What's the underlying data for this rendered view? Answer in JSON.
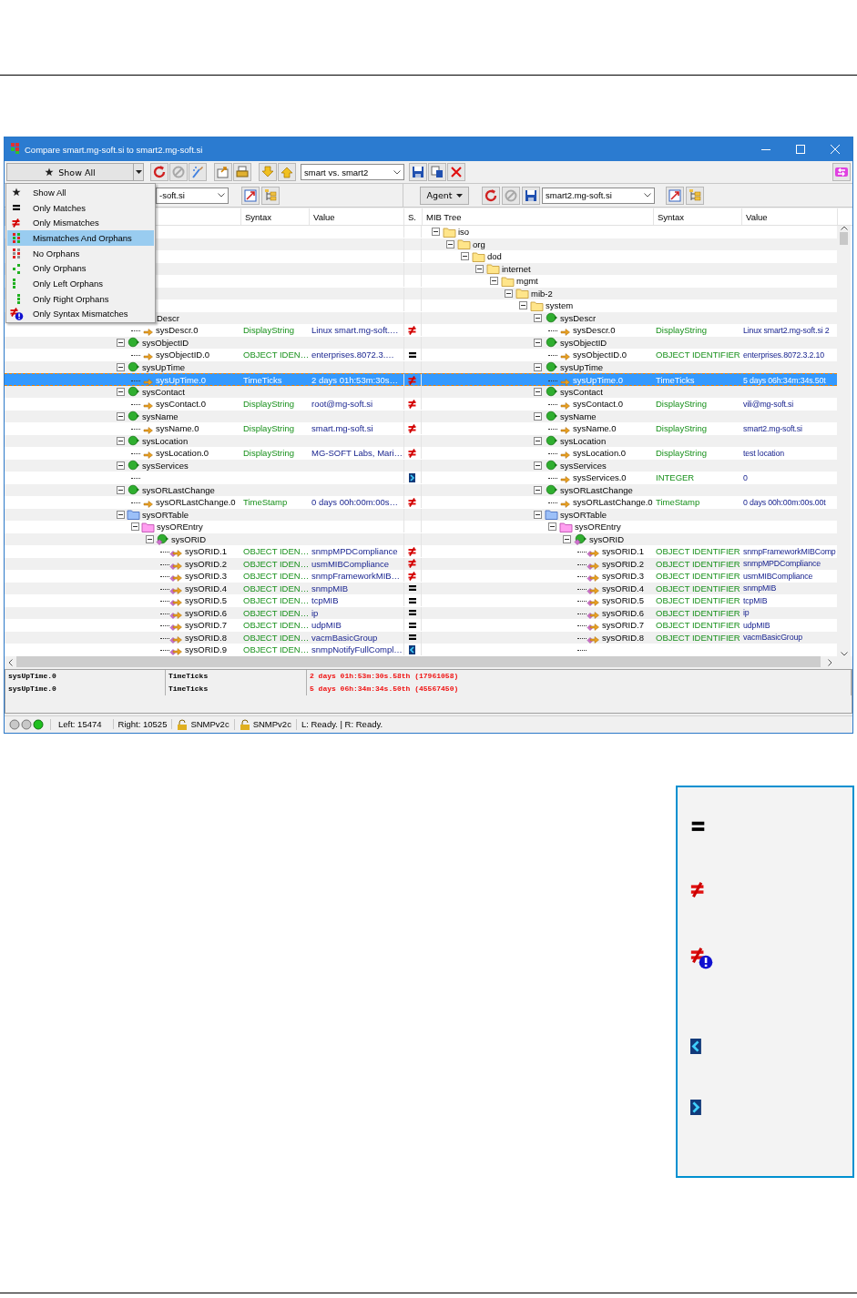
{
  "window": {
    "title": "Compare smart.mg-soft.si to smart2.mg-soft.si"
  },
  "toolbar": {
    "filter": "Show All",
    "profile": "smart vs. smart2"
  },
  "menu": {
    "items": [
      {
        "kind": "all",
        "label": "Show All",
        "selected": false
      },
      {
        "kind": "matches",
        "label": "Only Matches",
        "selected": false
      },
      {
        "kind": "mismatches",
        "label": "Only Mismatches",
        "selected": false
      },
      {
        "kind": "mismatches_orphans",
        "label": "Mismatches And Orphans",
        "selected": true
      },
      {
        "kind": "no_orphans",
        "label": "No Orphans",
        "selected": false
      },
      {
        "kind": "orphans",
        "label": "Only Orphans",
        "selected": false
      },
      {
        "kind": "left_orphans",
        "label": "Only Left Orphans",
        "selected": false
      },
      {
        "kind": "right_orphans",
        "label": "Only Right Orphans",
        "selected": false
      },
      {
        "kind": "syntax",
        "label": "Only Syntax Mismatches",
        "selected": false
      }
    ]
  },
  "left_pane": {
    "agent_file": "-soft.si"
  },
  "right_pane": {
    "agent_button": "Agent",
    "agent_file": "smart2.mg-soft.si"
  },
  "columns": {
    "left": [
      "Syntax",
      "Value"
    ],
    "status": "S.",
    "right": [
      "MIB Tree",
      "Syntax",
      "Value"
    ]
  },
  "tree": [
    {
      "kind": "folder",
      "right": {
        "name": "iso"
      },
      "expanded": true,
      "selected": false,
      "children": [
        {
          "kind": "folder",
          "right": {
            "name": "org"
          },
          "expanded": true,
          "selected": false,
          "children": [
            {
              "kind": "folder",
              "right": {
                "name": "dod"
              },
              "expanded": true,
              "selected": false,
              "children": [
                {
                  "kind": "folder",
                  "right": {
                    "name": "internet"
                  },
                  "expanded": true,
                  "selected": false,
                  "children": [
                    {
                      "kind": "folder",
                      "right": {
                        "name": "mgmt"
                      },
                      "expanded": true,
                      "selected": false,
                      "children": [
                        {
                          "kind": "folder",
                          "right": {
                            "name": "mib-2"
                          },
                          "expanded": true,
                          "selected": false,
                          "children": [
                            {
                              "kind": "folder",
                              "right": {
                                "name": "system"
                              },
                              "expanded": true,
                              "selected": false,
                              "children": [
                                {
                                  "kind": "node",
                                  "left": {
                                    "name": "Descr",
                                    "cut": true
                                  },
                                  "right": {
                                    "name": "sysDescr"
                                  },
                                  "expanded": true,
                                  "selected": false,
                                  "children": [
                                    {
                                      "kind": "leaf",
                                      "left": {
                                        "name": "sysDescr.0",
                                        "syntax": "DisplayString",
                                        "value": "Linux smart.mg-soft.…"
                                      },
                                      "right": {
                                        "name": "sysDescr.0",
                                        "syntax": "DisplayString",
                                        "value": "Linux smart2.mg-soft.si 2"
                                      },
                                      "status": {
                                        "kind": "mismatch"
                                      },
                                      "selected": false
                                    }
                                  ]
                                },
                                {
                                  "kind": "node",
                                  "left": {
                                    "name": "sysObjectID"
                                  },
                                  "right": {
                                    "name": "sysObjectID"
                                  },
                                  "expanded": true,
                                  "selected": false,
                                  "children": [
                                    {
                                      "kind": "leaf",
                                      "left": {
                                        "name": "sysObjectID.0",
                                        "syntax": "OBJECT IDEN…",
                                        "value": "enterprises.8072.3.…"
                                      },
                                      "right": {
                                        "name": "sysObjectID.0",
                                        "syntax": "OBJECT IDENTIFIER",
                                        "value": "enterprises.8072.3.2.10"
                                      },
                                      "status": {
                                        "kind": "equal"
                                      },
                                      "selected": false
                                    }
                                  ]
                                },
                                {
                                  "kind": "node",
                                  "left": {
                                    "name": "sysUpTime"
                                  },
                                  "right": {
                                    "name": "sysUpTime"
                                  },
                                  "expanded": true,
                                  "selected": false,
                                  "children": [
                                    {
                                      "kind": "leaf",
                                      "left": {
                                        "name": "sysUpTime.0",
                                        "syntax": "TimeTicks",
                                        "value": "2 days 01h:53m:30s…"
                                      },
                                      "right": {
                                        "name": "sysUpTime.0",
                                        "syntax": "TimeTicks",
                                        "value": "5 days 06h:34m:34s.50t"
                                      },
                                      "status": {
                                        "kind": "mismatch"
                                      },
                                      "selected": true
                                    }
                                  ]
                                },
                                {
                                  "kind": "node",
                                  "left": {
                                    "name": "sysContact"
                                  },
                                  "right": {
                                    "name": "sysContact"
                                  },
                                  "expanded": true,
                                  "selected": false,
                                  "children": [
                                    {
                                      "kind": "leaf",
                                      "left": {
                                        "name": "sysContact.0",
                                        "syntax": "DisplayString",
                                        "value": "root@mg-soft.si"
                                      },
                                      "right": {
                                        "name": "sysContact.0",
                                        "syntax": "DisplayString",
                                        "value": "vili@mg-soft.si"
                                      },
                                      "status": {
                                        "kind": "mismatch"
                                      },
                                      "selected": false
                                    }
                                  ]
                                },
                                {
                                  "kind": "node",
                                  "left": {
                                    "name": "sysName"
                                  },
                                  "right": {
                                    "name": "sysName"
                                  },
                                  "expanded": true,
                                  "selected": false,
                                  "children": [
                                    {
                                      "kind": "leaf",
                                      "left": {
                                        "name": "sysName.0",
                                        "syntax": "DisplayString",
                                        "value": "smart.mg-soft.si"
                                      },
                                      "right": {
                                        "name": "sysName.0",
                                        "syntax": "DisplayString",
                                        "value": "smart2.mg-soft.si"
                                      },
                                      "status": {
                                        "kind": "mismatch"
                                      },
                                      "selected": false
                                    }
                                  ]
                                },
                                {
                                  "kind": "node",
                                  "left": {
                                    "name": "sysLocation"
                                  },
                                  "right": {
                                    "name": "sysLocation"
                                  },
                                  "expanded": true,
                                  "selected": false,
                                  "children": [
                                    {
                                      "kind": "leaf",
                                      "left": {
                                        "name": "sysLocation.0",
                                        "syntax": "DisplayString",
                                        "value": "MG-SOFT Labs, Mari…"
                                      },
                                      "right": {
                                        "name": "sysLocation.0",
                                        "syntax": "DisplayString",
                                        "value": "test location"
                                      },
                                      "status": {
                                        "kind": "mismatch"
                                      },
                                      "selected": false
                                    }
                                  ]
                                },
                                {
                                  "kind": "node",
                                  "left": {
                                    "name": "sysServices"
                                  },
                                  "right": {
                                    "name": "sysServices"
                                  },
                                  "expanded": true,
                                  "selected": false,
                                  "children": [
                                    {
                                      "kind": "leaf",
                                      "right": {
                                        "name": "sysServices.0",
                                        "syntax": "INTEGER",
                                        "value": "0"
                                      },
                                      "status": {
                                        "kind": "right_only"
                                      },
                                      "selected": false
                                    }
                                  ]
                                },
                                {
                                  "kind": "node",
                                  "left": {
                                    "name": "sysORLastChange"
                                  },
                                  "right": {
                                    "name": "sysORLastChange"
                                  },
                                  "expanded": true,
                                  "selected": false,
                                  "children": [
                                    {
                                      "kind": "leaf",
                                      "left": {
                                        "name": "sysORLastChange.0",
                                        "syntax": "TimeStamp",
                                        "value": "0 days 00h:00m:00s…"
                                      },
                                      "right": {
                                        "name": "sysORLastChange.0",
                                        "syntax": "TimeStamp",
                                        "value": "0 days 00h:00m:00s.00t"
                                      },
                                      "status": {
                                        "kind": "mismatch"
                                      },
                                      "selected": false
                                    }
                                  ]
                                },
                                {
                                  "kind": "table",
                                  "left": {
                                    "name": "sysORTable"
                                  },
                                  "right": {
                                    "name": "sysORTable"
                                  },
                                  "expanded": true,
                                  "selected": false,
                                  "children": [
                                    {
                                      "kind": "entry",
                                      "left": {
                                        "name": "sysOREntry"
                                      },
                                      "right": {
                                        "name": "sysOREntry"
                                      },
                                      "expanded": true,
                                      "selected": false,
                                      "children": [
                                        {
                                          "kind": "column",
                                          "left": {
                                            "name": "sysORID"
                                          },
                                          "right": {
                                            "name": "sysORID"
                                          },
                                          "expanded": true,
                                          "selected": false,
                                          "children": [
                                            {
                                              "kind": "instance",
                                              "left": {
                                                "name": "sysORID.1",
                                                "syntax": "OBJECT IDEN…",
                                                "value": "snmpMPDCompliance"
                                              },
                                              "right": {
                                                "name": "sysORID.1",
                                                "syntax": "OBJECT IDENTIFIER",
                                                "value": "snmpFrameworkMIBComp"
                                              },
                                              "status": {
                                                "kind": "mismatch"
                                              },
                                              "selected": false
                                            },
                                            {
                                              "kind": "instance",
                                              "left": {
                                                "name": "sysORID.2",
                                                "syntax": "OBJECT IDEN…",
                                                "value": "usmMIBCompliance"
                                              },
                                              "right": {
                                                "name": "sysORID.2",
                                                "syntax": "OBJECT IDENTIFIER",
                                                "value": "snmpMPDCompliance"
                                              },
                                              "status": {
                                                "kind": "mismatch"
                                              },
                                              "selected": false
                                            },
                                            {
                                              "kind": "instance",
                                              "left": {
                                                "name": "sysORID.3",
                                                "syntax": "OBJECT IDEN…",
                                                "value": "snmpFrameworkMIB…"
                                              },
                                              "right": {
                                                "name": "sysORID.3",
                                                "syntax": "OBJECT IDENTIFIER",
                                                "value": "usmMIBCompliance"
                                              },
                                              "status": {
                                                "kind": "mismatch"
                                              },
                                              "selected": false
                                            },
                                            {
                                              "kind": "instance",
                                              "left": {
                                                "name": "sysORID.4",
                                                "syntax": "OBJECT IDEN…",
                                                "value": "snmpMIB"
                                              },
                                              "right": {
                                                "name": "sysORID.4",
                                                "syntax": "OBJECT IDENTIFIER",
                                                "value": "snmpMIB"
                                              },
                                              "status": {
                                                "kind": "equal"
                                              },
                                              "selected": false
                                            },
                                            {
                                              "kind": "instance",
                                              "left": {
                                                "name": "sysORID.5",
                                                "syntax": "OBJECT IDEN…",
                                                "value": "tcpMIB"
                                              },
                                              "right": {
                                                "name": "sysORID.5",
                                                "syntax": "OBJECT IDENTIFIER",
                                                "value": "tcpMIB"
                                              },
                                              "status": {
                                                "kind": "equal"
                                              },
                                              "selected": false
                                            },
                                            {
                                              "kind": "instance",
                                              "left": {
                                                "name": "sysORID.6",
                                                "syntax": "OBJECT IDEN…",
                                                "value": "ip"
                                              },
                                              "right": {
                                                "name": "sysORID.6",
                                                "syntax": "OBJECT IDENTIFIER",
                                                "value": "ip"
                                              },
                                              "status": {
                                                "kind": "equal"
                                              },
                                              "selected": false
                                            },
                                            {
                                              "kind": "instance",
                                              "left": {
                                                "name": "sysORID.7",
                                                "syntax": "OBJECT IDEN…",
                                                "value": "udpMIB"
                                              },
                                              "right": {
                                                "name": "sysORID.7",
                                                "syntax": "OBJECT IDENTIFIER",
                                                "value": "udpMIB"
                                              },
                                              "status": {
                                                "kind": "equal"
                                              },
                                              "selected": false
                                            },
                                            {
                                              "kind": "instance",
                                              "left": {
                                                "name": "sysORID.8",
                                                "syntax": "OBJECT IDEN…",
                                                "value": "vacmBasicGroup"
                                              },
                                              "right": {
                                                "name": "sysORID.8",
                                                "syntax": "OBJECT IDENTIFIER",
                                                "value": "vacmBasicGroup"
                                              },
                                              "status": {
                                                "kind": "equal"
                                              },
                                              "selected": false
                                            },
                                            {
                                              "kind": "instance",
                                              "left": {
                                                "name": "sysORID.9",
                                                "syntax": "OBJECT IDEN…",
                                                "value": "snmpNotifyFullCompl…"
                                              },
                                              "status": {
                                                "kind": "left_only"
                                              },
                                              "selected": false
                                            }
                                          ]
                                        }
                                      ]
                                    }
                                  ]
                                }
                              ]
                            }
                          ]
                        }
                      ]
                    }
                  ]
                }
              ]
            }
          ]
        }
      ]
    }
  ],
  "details": [
    {
      "name": "sysUpTime.0",
      "syntax": "TimeTicks",
      "value": "2 days 01h:53m:30s.58th (17961058)"
    },
    {
      "name": "sysUpTime.0",
      "syntax": "TimeTicks",
      "value": "5 days 06h:34m:34s.50th (45567450)"
    }
  ],
  "status_bar": {
    "left_count": "Left: 15474",
    "right_count": "Right: 10525",
    "left_version": "SNMPv2c",
    "right_version": "SNMPv2c",
    "state": "L: Ready. | R: Ready."
  },
  "legend": [
    {
      "kind": "equal"
    },
    {
      "kind": "mismatch"
    },
    {
      "kind": "syntax"
    },
    {
      "kind": "left_only"
    },
    {
      "kind": "right_only"
    }
  ]
}
